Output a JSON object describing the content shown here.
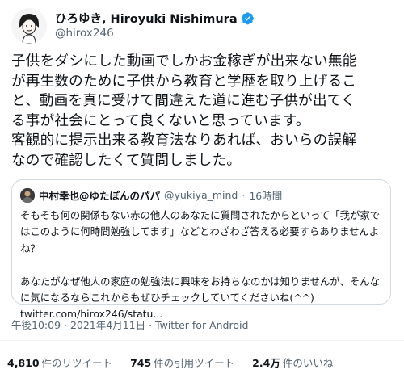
{
  "author": {
    "display_name": "ひろゆき, Hiroyuki Nishimura",
    "handle": "@hirox246"
  },
  "tweet": {
    "text": "子供をダシにした動画でしかお金稼ぎが出来ない無能\nが再生数のために子供から教育と学歴を取り上げるこ\nと、動画を真に受けて間違えた道に進む子供が出てく\nる事が社会にとって良くないと思っています。\n客観的に提示出来る教育法なりあれば、おいらの誤解\nなので確認したくて質問しました。"
  },
  "quote": {
    "display_name": "中村幸也@ゆたぽんのパパ",
    "handle": "@yukiya_mind",
    "separator": "·",
    "time": "16時間",
    "text": "そもそも何の関係もない赤の他人のあなたに質問されたからといって「我が家で\nはこのように何時間勉強してます」などとわざわざ答える必要すらありませんよ\nね？\n\nあなたがなぜ他人の家庭の勉強法に興味をお持ちなのかは知りませんが、そんな\nに気になるならこれからもぜひチェックしていてくださいね(^^)\ntwitter.com/hirox246/statu..."
  },
  "meta": {
    "line": "午後10:09 · 2021年4月11日 · Twitter for Android"
  },
  "stats": {
    "retweets_count": "4,810",
    "retweets_label": "件のリツイート",
    "quotes_count": "745",
    "quotes_label": "件の引用ツイート",
    "likes_count": "2.4万",
    "likes_label": "件のいいね"
  },
  "colors": {
    "verified": "#1d9bf0",
    "secondary_text": "#536471",
    "border": "#cfd9de"
  },
  "icons": {
    "verified": "verified-badge-icon"
  }
}
